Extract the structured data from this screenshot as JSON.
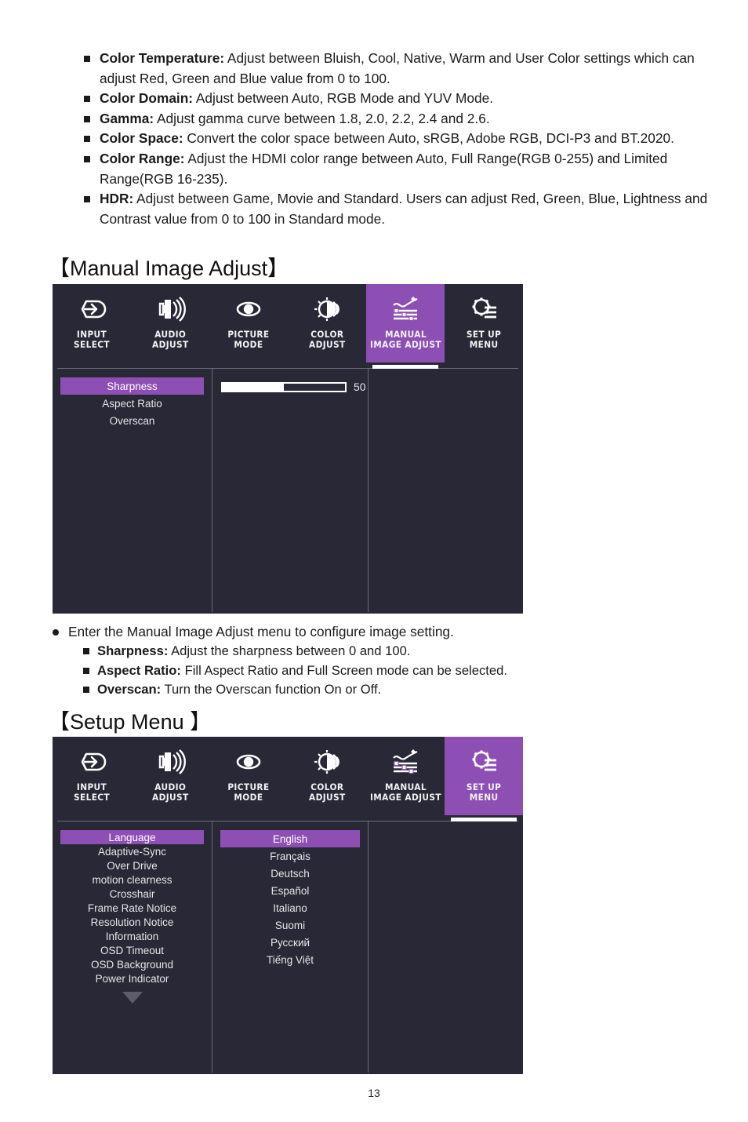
{
  "colors": {
    "accent_purple": "#8e4fb5",
    "osd_background": "#282836",
    "osd_text": "#e6e6ea",
    "divider": "#6b6b78"
  },
  "top_bullets": [
    {
      "term": "Color Temperature:",
      "text": " Adjust between Bluish, Cool, Native, Warm and User Color settings which can adjust Red, Green and Blue value from 0 to 100."
    },
    {
      "term": "Color Domain:",
      "text": " Adjust between Auto, RGB Mode and YUV Mode."
    },
    {
      "term": "Gamma:",
      "text": " Adjust gamma curve between 1.8, 2.0, 2.2, 2.4 and 2.6."
    },
    {
      "term": "Color Space:",
      "text": " Convert the color space between Auto, sRGB, Adobe RGB, DCI-P3 and BT.2020."
    },
    {
      "term": "Color Range:",
      "text": " Adjust the HDMI color range between Auto, Full Range(RGB 0-255) and Limited Range(RGB 16-235)."
    },
    {
      "term": "HDR:",
      "text": " Adjust between Game, Movie and Standard. Users can adjust Red, Green, Blue, Lightness and Contrast value from 0 to 100 in Standard mode."
    }
  ],
  "section1": {
    "heading": "【Manual Image Adjust】",
    "osd": {
      "tabs": [
        {
          "label": "INPUT\nSELECT",
          "icon": "input-select-icon",
          "active": false
        },
        {
          "label": "AUDIO\nADJUST",
          "icon": "audio-adjust-icon",
          "active": false
        },
        {
          "label": "PICTURE\nMODE",
          "icon": "picture-mode-icon",
          "active": false
        },
        {
          "label": "COLOR\nADJUST",
          "icon": "color-adjust-icon",
          "active": false
        },
        {
          "label": "MANUAL\nIMAGE ADJUST",
          "icon": "manual-image-adjust-icon",
          "active": true
        },
        {
          "label": "SET UP\nMENU",
          "icon": "set-up-menu-icon",
          "active": false
        }
      ],
      "menu_items": [
        {
          "label": "Sharpness",
          "selected": true
        },
        {
          "label": "Aspect Ratio",
          "selected": false
        },
        {
          "label": "Overscan",
          "selected": false
        }
      ],
      "slider": {
        "value": "50",
        "percent": 50,
        "min": 0,
        "max": 100
      }
    },
    "notes": {
      "intro": "Enter the Manual Image Adjust menu to configure image setting.",
      "items": [
        {
          "term": "Sharpness:",
          "text": " Adjust the sharpness between 0 and 100."
        },
        {
          "term": "Aspect Ratio:",
          "text": " Fill Aspect Ratio and Full Screen mode can be selected."
        },
        {
          "term": "Overscan:",
          "text": " Turn the Overscan function On or Off."
        }
      ]
    }
  },
  "section2": {
    "heading": "【Setup Menu 】",
    "osd": {
      "tabs": [
        {
          "label": "INPUT\nSELECT",
          "icon": "input-select-icon",
          "active": false
        },
        {
          "label": "AUDIO\nADJUST",
          "icon": "audio-adjust-icon",
          "active": false
        },
        {
          "label": "PICTURE\nMODE",
          "icon": "picture-mode-icon",
          "active": false
        },
        {
          "label": "COLOR\nADJUST",
          "icon": "color-adjust-icon",
          "active": false
        },
        {
          "label": "MANUAL\nIMAGE ADJUST",
          "icon": "manual-image-adjust-icon",
          "active": false
        },
        {
          "label": "SET UP\nMENU",
          "icon": "set-up-menu-icon",
          "active": true
        }
      ],
      "menu_items": [
        {
          "label": "Language",
          "selected": true
        },
        {
          "label": "Adaptive-Sync",
          "selected": false
        },
        {
          "label": "Over Drive",
          "selected": false
        },
        {
          "label": "motion clearness",
          "selected": false
        },
        {
          "label": "Crosshair",
          "selected": false
        },
        {
          "label": "Frame Rate Notice",
          "selected": false
        },
        {
          "label": "Resolution Notice",
          "selected": false
        },
        {
          "label": "Information",
          "selected": false
        },
        {
          "label": "OSD Timeout",
          "selected": false
        },
        {
          "label": "OSD Background",
          "selected": false
        },
        {
          "label": "Power Indicator",
          "selected": false
        }
      ],
      "more_indicator": "scroll-down-arrow",
      "options": [
        {
          "label": "English",
          "selected": true
        },
        {
          "label": "Français",
          "selected": false
        },
        {
          "label": "Deutsch",
          "selected": false
        },
        {
          "label": "Español",
          "selected": false
        },
        {
          "label": "Italiano",
          "selected": false
        },
        {
          "label": "Suomi",
          "selected": false
        },
        {
          "label": "Русский",
          "selected": false
        },
        {
          "label": "Tiếng Việt",
          "selected": false
        }
      ]
    }
  },
  "footer": {
    "page_number": "13"
  }
}
